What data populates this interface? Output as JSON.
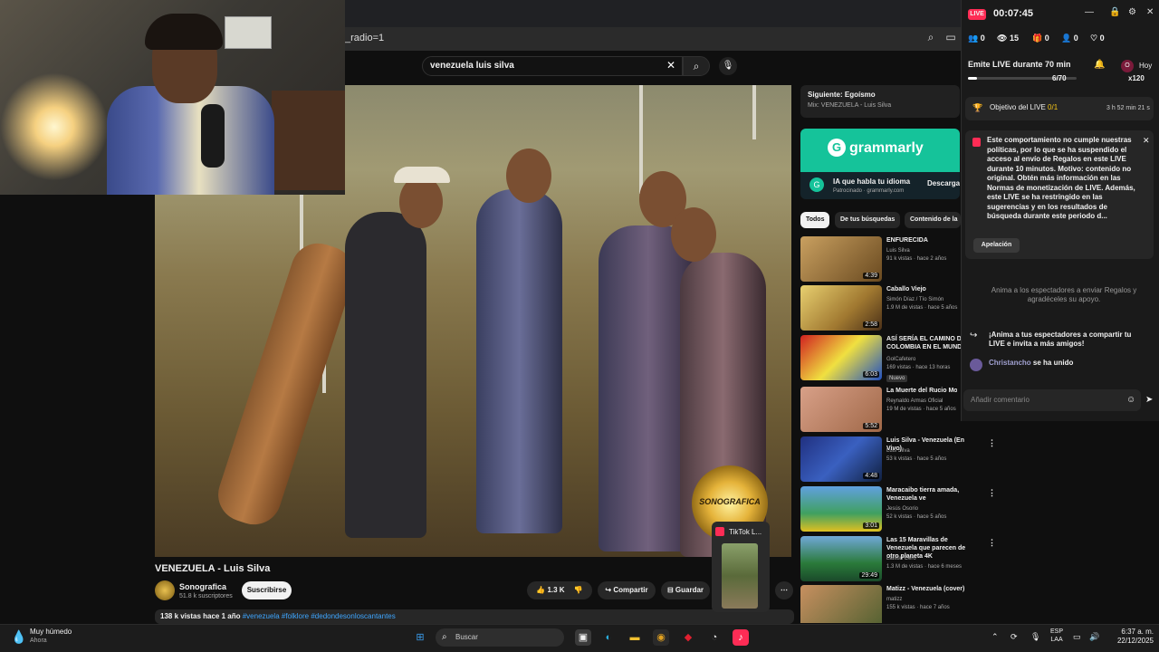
{
  "browser": {
    "address_fragment": "_radio=1"
  },
  "youtube": {
    "search_query": "venezuela luis silva",
    "video": {
      "title": "VENEZUELA - Luis Silva",
      "watermark": "SONOGRAFICA",
      "channel": "Sonografica",
      "subscribers": "51.8 k suscriptores",
      "subscribe_label": "Suscribirse",
      "likes": "1.3 K",
      "share_label": "Compartir",
      "save_label": "Guardar",
      "views_date": "138 k vistas  hace 1 año",
      "tags": "#venezuela #folklore #dedondesonloscantantes"
    },
    "next_up": {
      "title": "Siguiente: Egoísmo",
      "subtitle": "Mix: VENEZUELA - Luis Silva"
    },
    "ad": {
      "brand": "grammarly",
      "headline": "IA que habla tu idioma",
      "sponsored": "Patrocinado · grammarly.com",
      "cta": "Descarga"
    },
    "chips": [
      "Todos",
      "De tus búsquedas",
      "Contenido de la"
    ],
    "recommendations": [
      {
        "title": "ENFURECIDA",
        "channel": "Luis Silva",
        "meta": "91 k vistas · hace 2 años",
        "duration": "4:39"
      },
      {
        "title": "Caballo Viejo",
        "channel": "Simón Díaz / Tío Simón",
        "meta": "1.9 M de vistas · hace 5 años",
        "duration": "2:58"
      },
      {
        "title": "ASÍ SERÍA EL CAMINO DE COLOMBIA EN EL MUNDIAL",
        "channel": "GolCafetero",
        "meta": "169 vistas · hace 13 horas",
        "duration": "6:03",
        "badge": "Nuevo"
      },
      {
        "title": "La Muerte del Rucio Moro",
        "channel": "Reynaldo Armas Oficial",
        "meta": "19 M de vistas · hace 5 años",
        "duration": "5:52"
      },
      {
        "title": "Luis Silva - Venezuela (En Vivo)",
        "channel": "Luis Silva",
        "meta": "53 k vistas · hace 5 años",
        "duration": "4:48"
      },
      {
        "title": "Maracaibo tierra amada, Venezuela ve",
        "channel": "Jesús Osorio",
        "meta": "52 k vistas · hace 5 años",
        "duration": "3:01"
      },
      {
        "title": "Las 15 Maravillas de Venezuela que parecen de otro planeta 4K",
        "channel": "Latitud Cero",
        "meta": "1.3 M de vistas · hace 6 meses",
        "duration": "29:49"
      },
      {
        "title": "Matizz - Venezuela (cover)",
        "channel": "matizz",
        "meta": "155 k vistas · hace 7 años",
        "duration": ""
      }
    ]
  },
  "tiktok_live": {
    "badge": "LIVE",
    "timer": "00:07:45",
    "stats": {
      "viewers_a": "0",
      "views": "15",
      "gifts": "0",
      "followers": "0",
      "likes": "0"
    },
    "mission": "Emite LIVE durante 70 min",
    "mission_progress": "6/70",
    "mission_progress_fraction": 0.086,
    "hoy": "Hoy",
    "coins": "x120",
    "goal_label": "Objetivo del LIVE",
    "goal_count": "0/1",
    "goal_time": "3 h 52 min 21 s",
    "warning": "Este comportamiento no cumple nuestras políticas, por lo que se ha suspendido el acceso al envío de Regalos en este LIVE durante 10 minutos. Motivo: contenido no original. Obtén más información en las Normas de monetización de LIVE. Además, este LIVE se ha restringido en las sugerencias y en los resultados de búsqueda durante este periodo d...",
    "appeal_label": "Apelación",
    "encourage": "Anima a los espectadores a enviar Regalos y agradéceles su apoyo.",
    "share_prompt": "¡Anima a tus espectadores a compartir tu LIVE e invita a más amigos!",
    "joined_user": "Christancho",
    "joined_text": "se ha unido",
    "comment_placeholder": "Añadir comentario"
  },
  "tiktok_popup": {
    "label": "TikTok L..."
  },
  "taskbar": {
    "weather": "Muy húmedo",
    "weather_sub": "Ahora",
    "search_label": "Buscar",
    "lang_line1": "ESP",
    "lang_line2": "LAA",
    "time": "6:37 a. m.",
    "date": "22/12/2025"
  }
}
